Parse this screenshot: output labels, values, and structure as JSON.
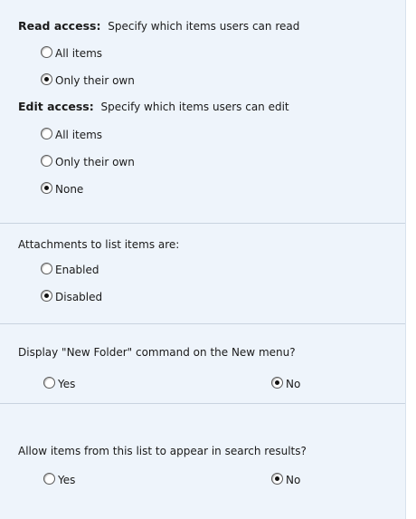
{
  "read_access": {
    "label": "Read access:",
    "description": "Specify which items users can read",
    "options": [
      {
        "label": "All items",
        "selected": false
      },
      {
        "label": "Only their own",
        "selected": true
      }
    ]
  },
  "edit_access": {
    "label": "Edit access:",
    "description": "Specify which items users can edit",
    "options": [
      {
        "label": "All items",
        "selected": false
      },
      {
        "label": "Only their own",
        "selected": false
      },
      {
        "label": "None",
        "selected": true
      }
    ]
  },
  "attachments": {
    "question": "Attachments to list items are:",
    "options": [
      {
        "label": "Enabled",
        "selected": false
      },
      {
        "label": "Disabled",
        "selected": true
      }
    ]
  },
  "new_folder": {
    "question": "Display \"New Folder\" command on the New menu?",
    "options": [
      {
        "label": "Yes",
        "selected": false
      },
      {
        "label": "No",
        "selected": true
      }
    ]
  },
  "search": {
    "question": "Allow items from this list to appear in search results?",
    "options": [
      {
        "label": "Yes",
        "selected": false
      },
      {
        "label": "No",
        "selected": true
      }
    ]
  }
}
